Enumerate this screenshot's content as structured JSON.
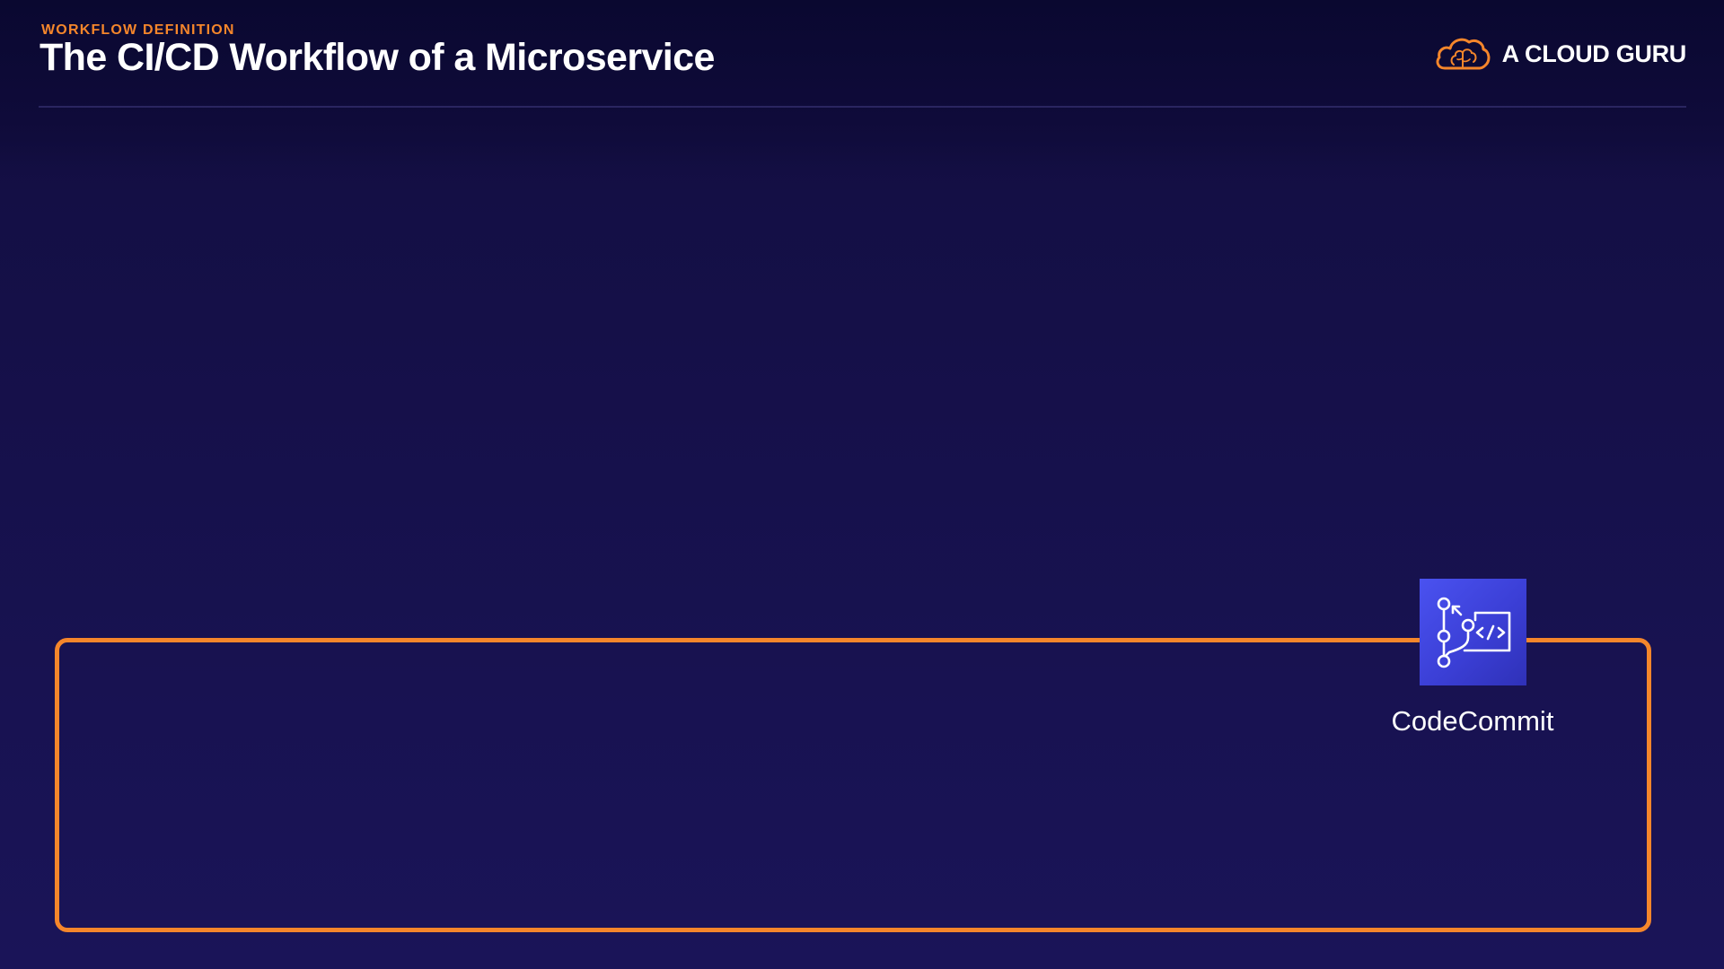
{
  "header": {
    "eyebrow": "WORKFLOW DEFINITION",
    "title": "The CI/CD Workflow of a Microservice"
  },
  "brand": {
    "name": "A CLOUD GURU",
    "logo_icon": "cloud-brain-icon",
    "logo_color": "#f5862b"
  },
  "diagram": {
    "container_border_color": "#f5862b",
    "services": [
      {
        "label": "CodeCommit",
        "icon": "codecommit-icon",
        "icon_color": "#3b3fd6"
      }
    ]
  },
  "colors": {
    "background": "#140f45",
    "accent": "#f5862b",
    "text": "#ffffff"
  }
}
